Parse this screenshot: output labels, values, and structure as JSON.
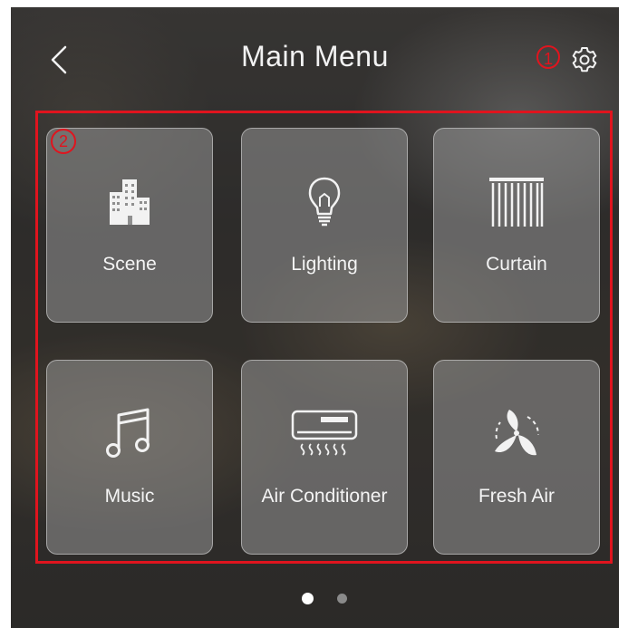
{
  "header": {
    "title": "Main Menu",
    "back_icon": "chevron-left-icon",
    "settings_icon": "gear-icon"
  },
  "annotations": {
    "marker_1": "1",
    "marker_2": "2",
    "highlight_color": "#e0141e"
  },
  "menu": {
    "items": [
      {
        "label": "Scene",
        "icon": "buildings-icon"
      },
      {
        "label": "Lighting",
        "icon": "lightbulb-icon"
      },
      {
        "label": "Curtain",
        "icon": "curtain-icon"
      },
      {
        "label": "Music",
        "icon": "music-note-icon"
      },
      {
        "label": "Air Conditioner",
        "icon": "air-conditioner-icon"
      },
      {
        "label": "Fresh Air",
        "icon": "fan-leaves-icon"
      }
    ]
  },
  "pagination": {
    "pages": 2,
    "current": 1
  }
}
